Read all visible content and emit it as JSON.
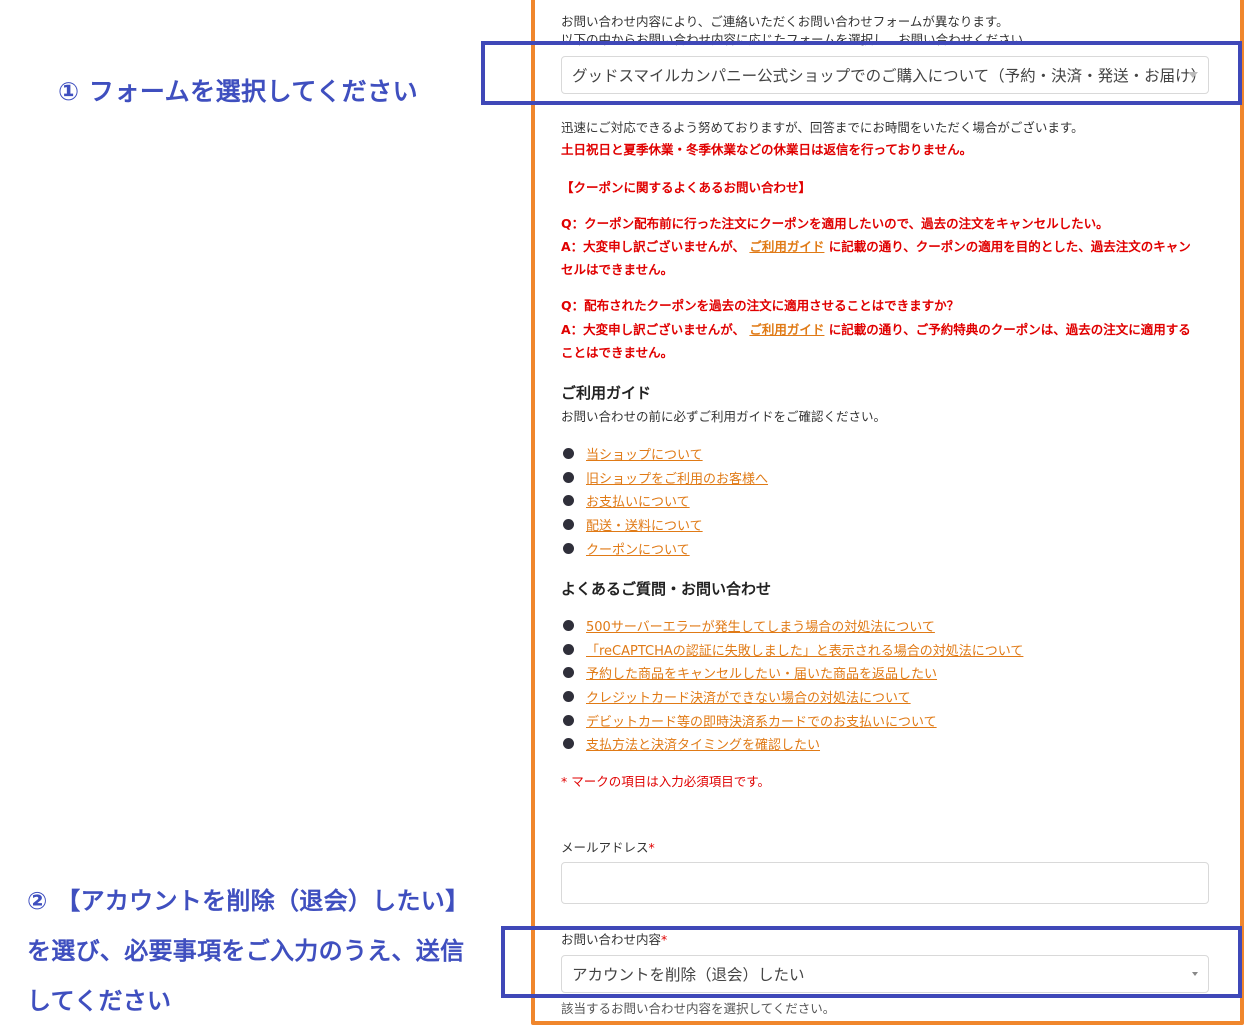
{
  "annotations": {
    "step1": "① フォームを選択してください",
    "step2_line1": "② 【アカウントを削除（退会）したい】",
    "step2_line2": "を選び、必要事項をご入力のうえ、送信",
    "step2_line3": "してください"
  },
  "intro": {
    "line1": "お問い合わせ内容により、ご連絡いただくお問い合わせフォームが異なります。",
    "line2": "以下の中からお問い合わせ内容に応じたフォームを選択し、お問い合わせください。"
  },
  "form_select": {
    "value": "グッドスマイルカンパニー公式ショップでのご購入について（予約・決済・発送・お届け）"
  },
  "notice": {
    "line1": "迅速にご対応できるよう努めておりますが、回答までにお時間をいただく場合がございます。",
    "line2": "土日祝日と夏季休業・冬季休業などの休業日は返信を行っておりません。"
  },
  "coupon_faq": {
    "title": "【クーポンに関するよくあるお問い合わせ】",
    "q1": "Q：クーポン配布前に行った注文にクーポンを適用したいので、過去の注文をキャンセルしたい。",
    "a1_prefix": "A：大変申し訳ございませんが、",
    "a1_link": "ご利用ガイド",
    "a1_suffix": "に記載の通り、クーポンの適用を目的とした、過去注文のキャン",
    "a1_line2": "セルはできません。",
    "q2": "Q：配布されたクーポンを過去の注文に適用させることはできますか？",
    "a2_prefix": "A：大変申し訳ございませんが、",
    "a2_link": "ご利用ガイド",
    "a2_suffix": "に記載の通り、ご予約特典のクーポンは、過去の注文に適用する",
    "a2_line2": "ことはできません。"
  },
  "guide": {
    "title": "ご利用ガイド",
    "subtitle": "お問い合わせの前に必ずご利用ガイドをご確認ください。",
    "links": [
      "当ショップについて",
      "旧ショップをご利用のお客様へ",
      "お支払いについて",
      "配送・送料について",
      "クーポンについて"
    ]
  },
  "faq": {
    "title": "よくあるご質問・お問い合わせ",
    "links": [
      "500サーバーエラーが発生してしまう場合の対処法について",
      "「reCAPTCHAの認証に失敗しました」と表示される場合の対処法について",
      "予約した商品をキャンセルしたい・届いた商品を返品したい",
      "クレジットカード決済ができない場合の対処法について",
      "デビットカード等の即時決済系カードでのお支払いについて",
      "支払方法と決済タイミングを確認したい"
    ]
  },
  "required_note": "* マークの項目は入力必須項目です。",
  "email": {
    "label": "メールアドレス",
    "required_mark": "*",
    "value": ""
  },
  "inquiry": {
    "label": "お問い合わせ内容",
    "required_mark": "*",
    "value": "アカウントを削除（退会）したい",
    "help": "該当するお問い合わせ内容を選択してください。"
  },
  "colors": {
    "accent_orange": "#f0862c",
    "highlight_blue": "#3f48b8",
    "alert_red": "#e00000",
    "link_orange": "#e07a16"
  }
}
